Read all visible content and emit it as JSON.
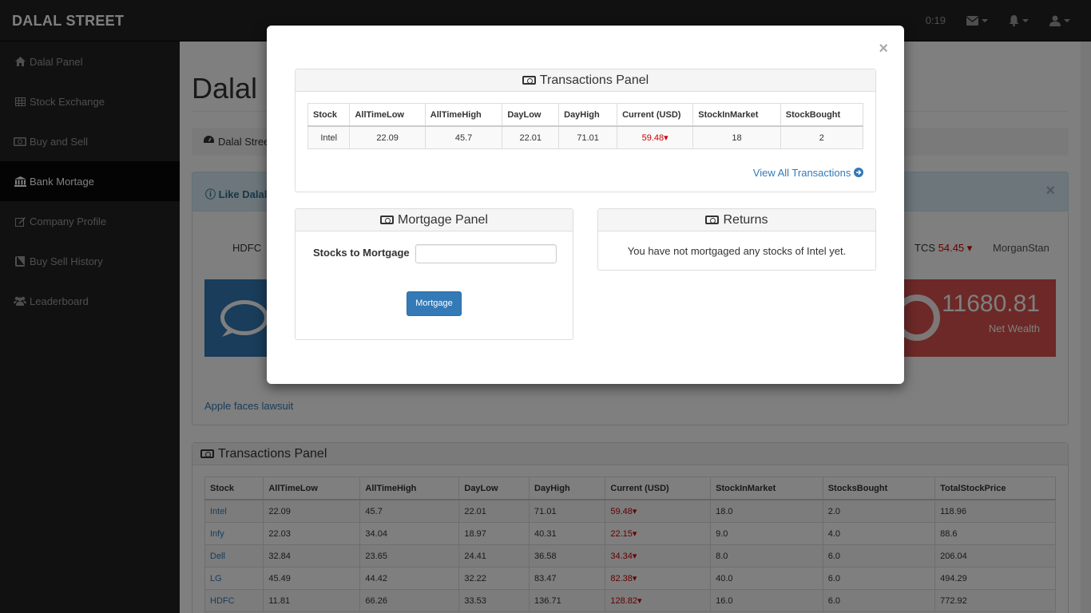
{
  "navbar": {
    "brand": "DALAL STREET",
    "time": "0:19"
  },
  "sidebar": {
    "items": [
      {
        "label": "Dalal Panel",
        "icon": "home-icon"
      },
      {
        "label": "Stock Exchange",
        "icon": "table-icon"
      },
      {
        "label": "Buy and Sell",
        "icon": "money-icon"
      },
      {
        "label": "Bank Mortage",
        "icon": "bank-icon"
      },
      {
        "label": "Company Profile",
        "icon": "edit-icon"
      },
      {
        "label": "Buy Sell History",
        "icon": "book-icon"
      },
      {
        "label": "Leaderboard",
        "icon": "users-icon"
      }
    ]
  },
  "background": {
    "page_title": "Dalal",
    "breadcrumb": "Dalal Stree",
    "alert_text": "Like Dalal",
    "ticker_left": "HDFC",
    "ticker_right_name": "TCS",
    "ticker_right_value": "54.45 ▾",
    "ticker_far": "MorganStan",
    "wealth_value": "11680.81",
    "wealth_label": "Net Wealth",
    "news": "Apple faces lawsuit",
    "transactions_title": "Transactions Panel",
    "table": {
      "headers": [
        "Stock",
        "AllTimeLow",
        "AllTimeHigh",
        "DayLow",
        "DayHigh",
        "Current (USD)",
        "StockInMarket",
        "StocksBought",
        "TotalStockPrice"
      ],
      "rows": [
        [
          "Intel",
          "22.09",
          "45.7",
          "22.01",
          "71.01",
          "59.48▾",
          "18.0",
          "2.0",
          "118.96"
        ],
        [
          "Infy",
          "22.03",
          "34.04",
          "18.97",
          "40.31",
          "22.15▾",
          "9.0",
          "4.0",
          "88.6"
        ],
        [
          "Dell",
          "32.84",
          "23.65",
          "24.41",
          "36.58",
          "34.34▾",
          "8.0",
          "6.0",
          "206.04"
        ],
        [
          "LG",
          "45.49",
          "44.42",
          "32.22",
          "83.47",
          "82.38▾",
          "40.0",
          "6.0",
          "494.29"
        ],
        [
          "HDFC",
          "11.81",
          "66.26",
          "33.53",
          "136.71",
          "128.82▾",
          "16.0",
          "6.0",
          "772.92"
        ]
      ]
    }
  },
  "modal": {
    "close": "×",
    "transactions": {
      "title": "Transactions Panel",
      "headers": [
        "Stock",
        "AllTimeLow",
        "AllTimeHigh",
        "DayLow",
        "DayHigh",
        "Current (USD)",
        "StockInMarket",
        "StockBought"
      ],
      "row": [
        "Intel",
        "22.09",
        "45.7",
        "22.01",
        "71.01",
        "59.48▾",
        "18",
        "2"
      ],
      "view_all": "View All Transactions"
    },
    "mortgage": {
      "title": "Mortgage Panel",
      "label": "Stocks to Mortgage",
      "input_value": "",
      "button": "Mortgage"
    },
    "returns": {
      "title": "Returns",
      "message": "You have not mortgaged any stocks of Intel yet."
    }
  },
  "colors": {
    "primary": "#337ab7",
    "danger": "#d9534f",
    "down": "#cc0000",
    "navbar": "#222222"
  }
}
